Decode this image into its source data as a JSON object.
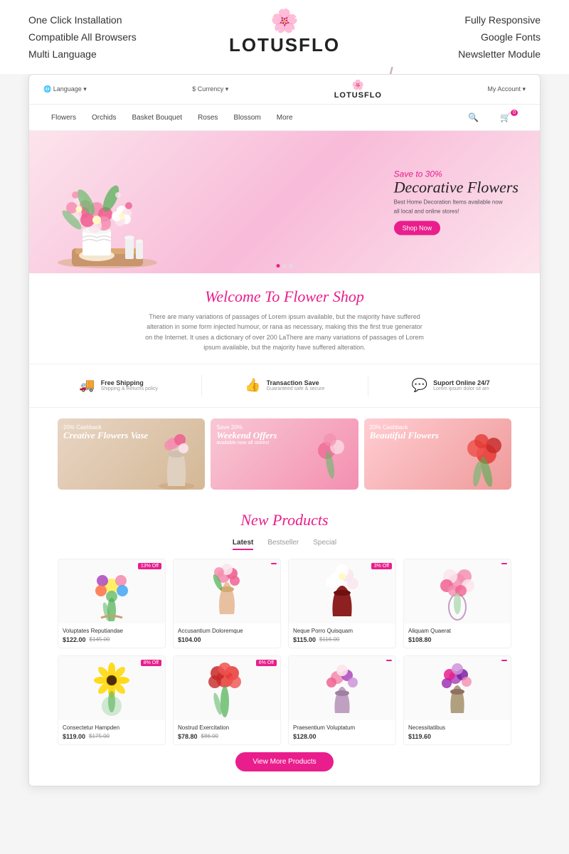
{
  "top": {
    "left_features": [
      "One Click Installation",
      "Compatible All Browsers",
      "Multi Language"
    ],
    "logo_icon": "🌸",
    "logo_text": "LOTUSFLO",
    "right_features": [
      "Fully Responsive",
      "Google Fonts",
      "Newsletter Module"
    ]
  },
  "store": {
    "topbar": {
      "language": "🌐 Language ▾",
      "currency": "$ Currency ▾",
      "logo_icon": "🌸",
      "logo_text": "LOTUSFLO",
      "account": "My Account ▾"
    },
    "nav": {
      "items": [
        "Flowers",
        "Orchids",
        "Basket Bouquet",
        "Roses",
        "Blossom",
        "More"
      ]
    },
    "hero": {
      "save_label": "Save to 30%",
      "title": "Decorative Flowers",
      "desc1": "Best Home Decoration Items available now",
      "desc2": "all local and online stores!",
      "btn": "Shop Now"
    },
    "welcome": {
      "title": "Welcome To Flower Shop",
      "text": "There are many variations of passages of Lorem ipsum available, but the majority have suffered alteration in some form injected humour, or rana as necessary, making this the first true generator on the Internet. It uses a dictionary of over 200 LaThere are many variations of passages of Lorem ipsum available, but the majority have suffered alteration."
    },
    "features": [
      {
        "icon": "🚚",
        "title": "Free Shipping",
        "sub": "Shipping & Returns policy"
      },
      {
        "icon": "👍",
        "title": "Transaction Save",
        "sub": "Guaranteed safe & secure"
      },
      {
        "icon": "💬",
        "title": "Suport Online 24/7",
        "sub": "Lorem ipsum dolor sit am"
      }
    ],
    "promos": [
      {
        "cashback": "20% Cashback",
        "title": "Creative Flowers Vase",
        "sub": "",
        "bg": "#e8d5c4"
      },
      {
        "cashback": "Save 20%",
        "title": "Weekend Offers",
        "sub": "available now all stores!",
        "bg": "#f8c8d4"
      },
      {
        "cashback": "20% Cashback",
        "title": "Beautiful Flowers",
        "sub": "",
        "bg": "#ffcdd2"
      }
    ],
    "products": {
      "section_title": "New Products",
      "tabs": [
        "Latest",
        "Bestseller",
        "Special"
      ],
      "active_tab": "Latest",
      "items": [
        {
          "name": "Voluptates Reputiandae",
          "price": "$122.00",
          "old_price": "$145.00",
          "badge": "13% Off"
        },
        {
          "name": "Accusantium Doloremque",
          "price": "$104.00",
          "old_price": "",
          "badge": ""
        },
        {
          "name": "Neque Porro Quisquam",
          "price": "$115.00",
          "old_price": "$116.00",
          "badge": "3% Off"
        },
        {
          "name": "Aliquam Quaerat",
          "price": "$108.80",
          "old_price": "",
          "badge": ""
        },
        {
          "name": "Consectetur Hampden",
          "price": "$119.00",
          "old_price": "$175.00",
          "badge": "8% Off"
        },
        {
          "name": "Nostrud Exercitation",
          "price": "$78.80",
          "old_price": "$86.00",
          "badge": "6% Off"
        },
        {
          "name": "Praesentium Voluptatum",
          "price": "$128.00",
          "old_price": "",
          "badge": ""
        },
        {
          "name": "Necessitatibus",
          "price": "$119.60",
          "old_price": "",
          "badge": ""
        }
      ],
      "view_more_btn": "View More Products"
    }
  }
}
